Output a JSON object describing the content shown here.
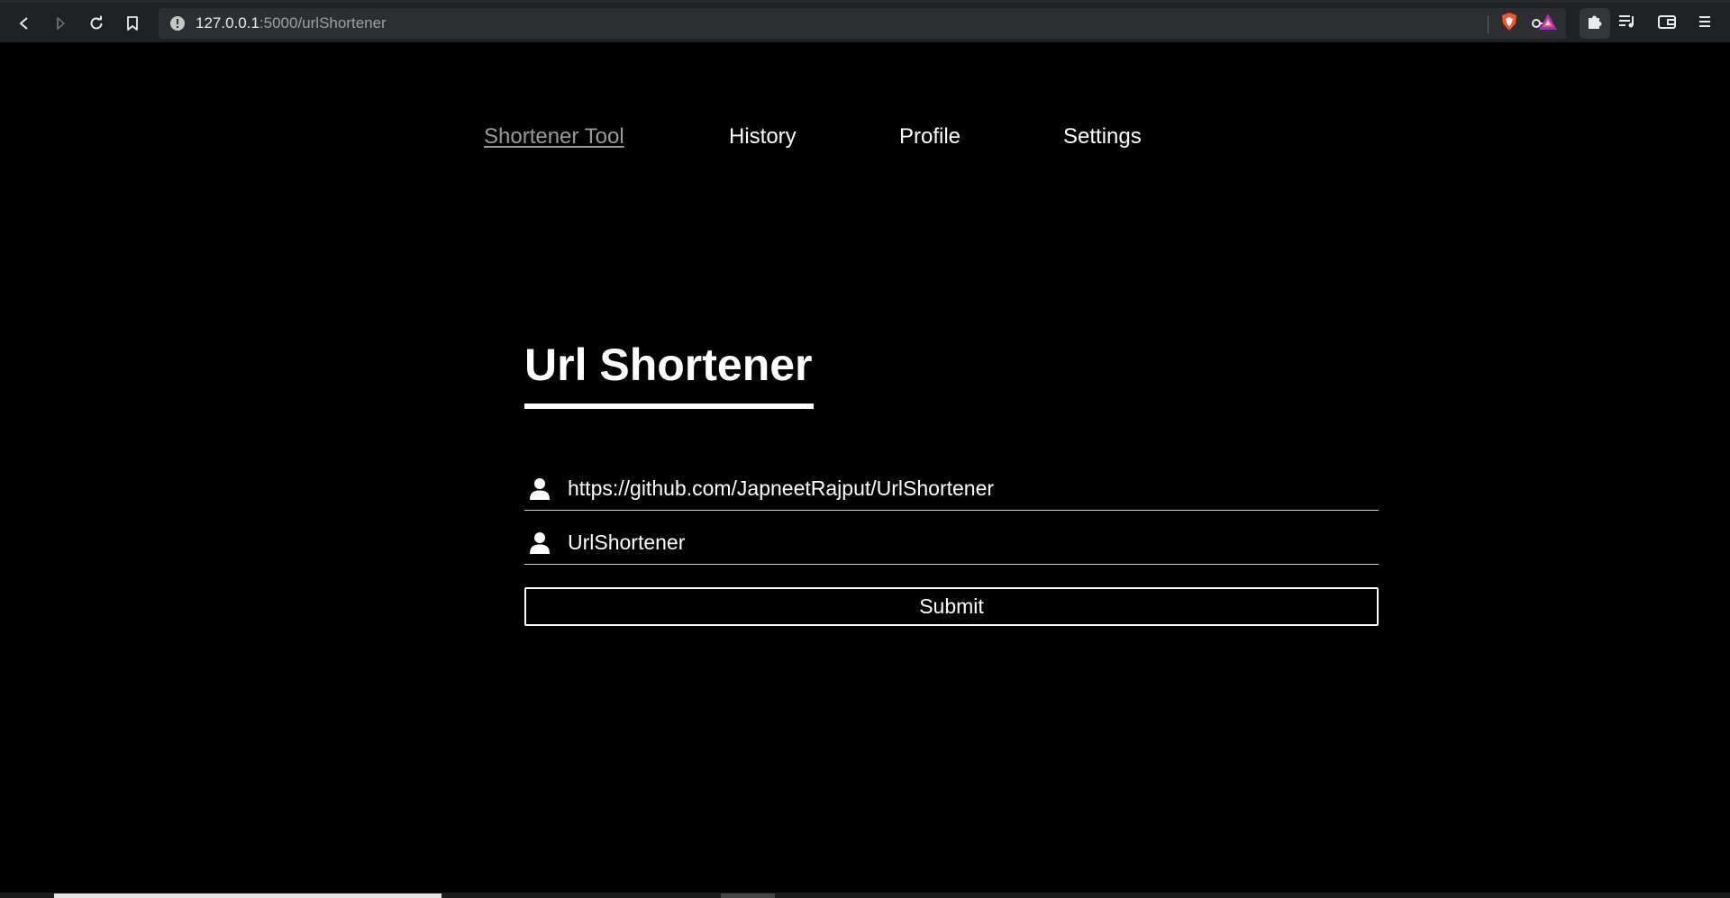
{
  "browser": {
    "url_host": "127.0.0.1",
    "url_path": ":5000/urlShortener",
    "icons": {
      "back": "back-icon",
      "forward": "forward-icon",
      "reload": "reload-icon",
      "bookmark": "bookmark-icon",
      "site_info": "info-icon",
      "passwords": "key-icon",
      "brave_shields": "brave-shield-icon",
      "brave_rewards": "brave-rewards-icon",
      "extensions": "puzzle-icon",
      "playlist": "playlist-icon",
      "wallet": "wallet-icon",
      "menu": "hamburger-menu-icon"
    }
  },
  "nav": {
    "items": [
      {
        "label": "Shortener Tool",
        "active": true
      },
      {
        "label": "History",
        "active": false
      },
      {
        "label": "Profile",
        "active": false
      },
      {
        "label": "Settings",
        "active": false
      }
    ]
  },
  "form": {
    "title": "Url Shortener",
    "url_field": {
      "value": "https://github.com/JapneetRajput/UrlShortener",
      "icon": "user-icon"
    },
    "alias_field": {
      "value": "UrlShortener",
      "icon": "user-icon"
    },
    "submit_label": "Submit"
  },
  "colors": {
    "page_background": "#000000",
    "text": "#ffffff",
    "active_nav": "#9a9a9a",
    "chrome_bar": "#202124",
    "omnibox": "#2d2e31"
  }
}
